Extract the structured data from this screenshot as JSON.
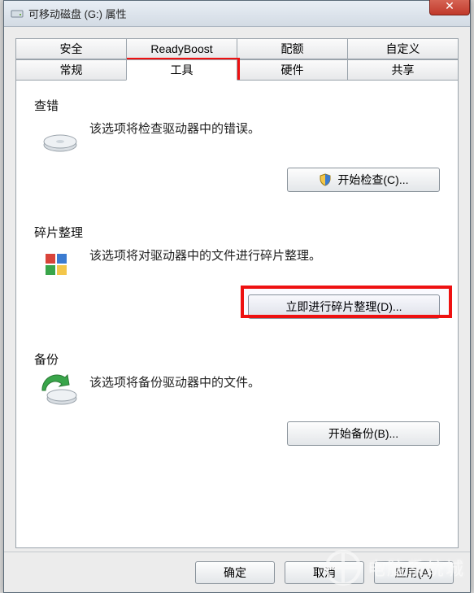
{
  "window": {
    "title": "可移动磁盘 (G:) 属性"
  },
  "tabs": {
    "row1": [
      "安全",
      "ReadyBoost",
      "配额",
      "自定义"
    ],
    "row2": [
      "常规",
      "工具",
      "硬件",
      "共享"
    ],
    "active": "工具"
  },
  "sections": {
    "check": {
      "title": "查错",
      "desc": "该选项将检查驱动器中的错误。",
      "button": "开始检查(C)..."
    },
    "defrag": {
      "title": "碎片整理",
      "desc": "该选项将对驱动器中的文件进行碎片整理。",
      "button": "立即进行碎片整理(D)..."
    },
    "backup": {
      "title": "备份",
      "desc": "该选项将备份驱动器中的文件。",
      "button": "开始备份(B)..."
    }
  },
  "footer": {
    "ok": "确定",
    "cancel": "取消",
    "apply": "应用(A)"
  },
  "watermark": "电脑系统城"
}
